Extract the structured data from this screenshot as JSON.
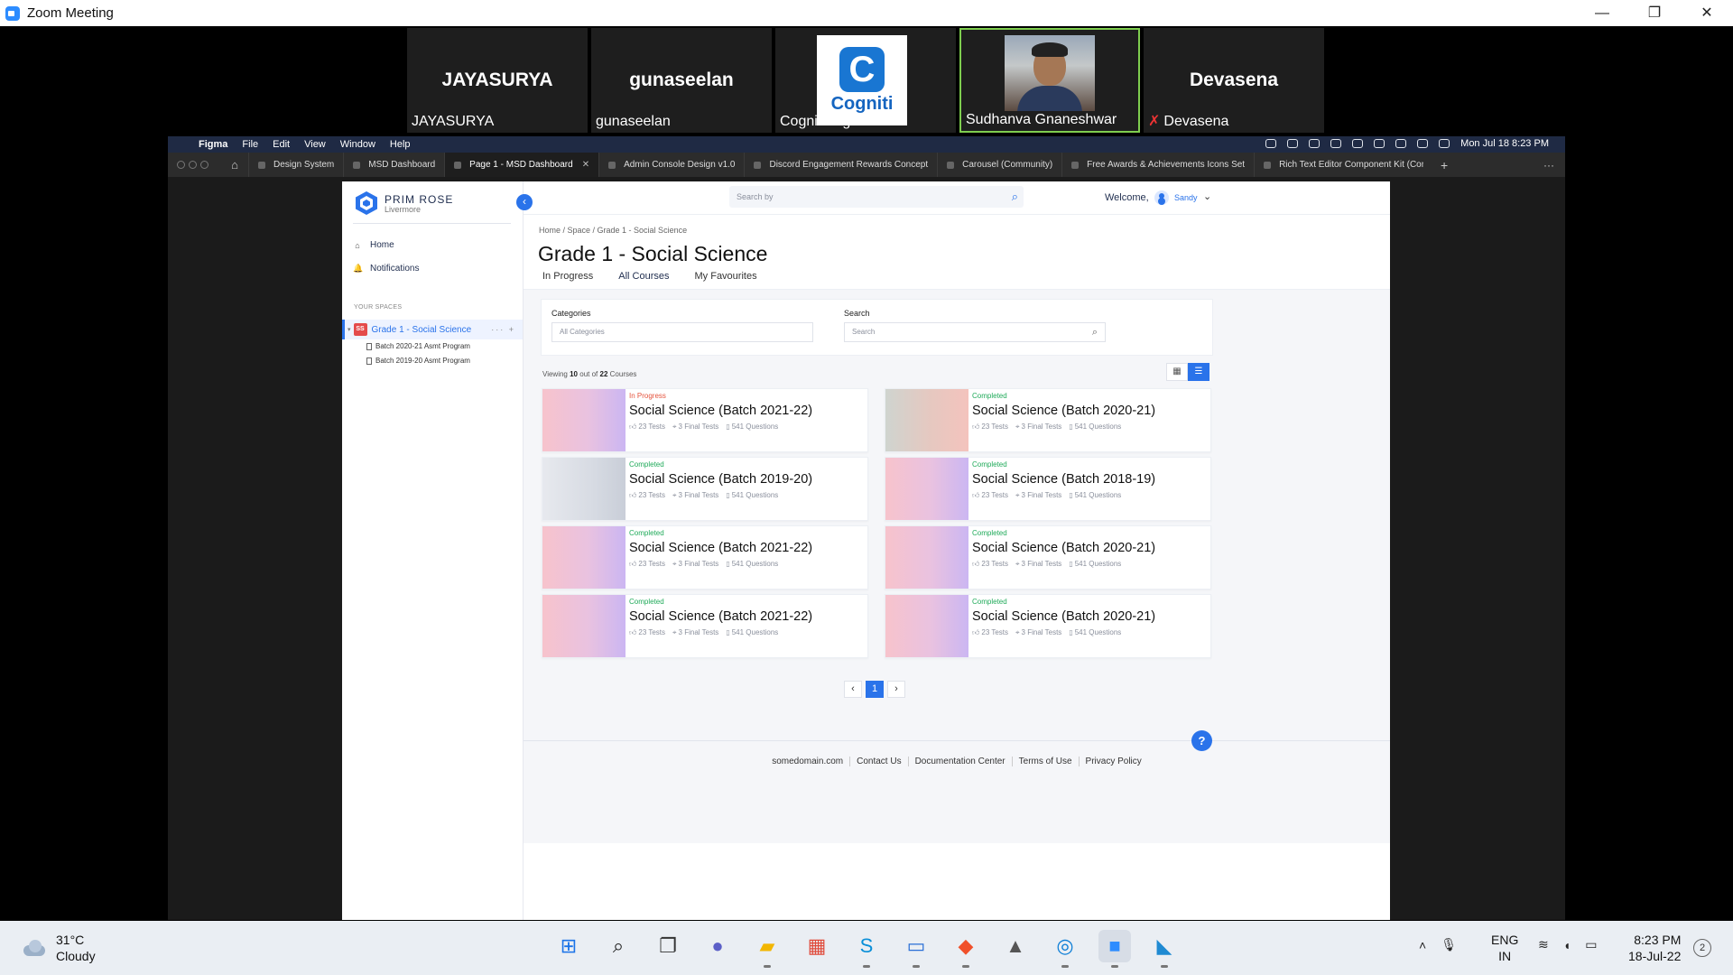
{
  "zoom": {
    "title": "Zoom Meeting",
    "window_controls": [
      "—",
      "❐",
      "✕"
    ],
    "participants": [
      {
        "display": "JAYASURYA",
        "name": "JAYASURYA",
        "kind": "text",
        "muted": false
      },
      {
        "display": "gunaseelan",
        "name": "gunaseelan",
        "kind": "text",
        "muted": false
      },
      {
        "display": "",
        "name": "Cogniti Digital",
        "kind": "logo",
        "muted": false,
        "logo_letter": "C",
        "logo_text": "Cogniti"
      },
      {
        "display": "",
        "name": "Sudhanva Gnaneshwar",
        "kind": "video",
        "muted": false,
        "active": true
      },
      {
        "display": "Devasena",
        "name": "Devasena",
        "kind": "text",
        "muted": true
      }
    ]
  },
  "mac_menubar": {
    "app": "Figma",
    "menus": [
      "File",
      "Edit",
      "View",
      "Window",
      "Help"
    ],
    "clock": "Mon Jul 18  8:23 PM"
  },
  "figma_tabs": [
    {
      "label": "Design System",
      "active": false
    },
    {
      "label": "MSD Dashboard",
      "active": false
    },
    {
      "label": "Page 1 - MSD Dashboard",
      "active": true
    },
    {
      "label": "Admin Console Design v1.0",
      "active": false
    },
    {
      "label": "Discord Engagement Rewards Concept",
      "active": false
    },
    {
      "label": "Carousel (Community)",
      "active": false
    },
    {
      "label": "Free Awards & Achievements Icons Set",
      "active": false
    },
    {
      "label": "Rich Text Editor Component Kit (Comm",
      "active": false
    }
  ],
  "app": {
    "brand": {
      "name": "PRIM ROSE",
      "location": "Livermore"
    },
    "nav": [
      {
        "label": "Home",
        "icon": "home-icon",
        "glyph": "⌂"
      },
      {
        "label": "Notifications",
        "icon": "bell-icon",
        "glyph": "🔔"
      }
    ],
    "your_spaces_label": "YOUR SPACES",
    "space": {
      "badge": "SS",
      "label": "Grade 1 - Social Science",
      "actions": "··· +"
    },
    "sub_items": [
      "Batch 2020-21 Asmt Program",
      "Batch 2019-20 Asmt Program"
    ],
    "search_placeholder": "Search by",
    "welcome": "Welcome,",
    "user": "Sandy",
    "breadcrumb": "Home / Space / Grade 1 - Social Science",
    "page_title": "Grade 1 - Social Science",
    "tabs": [
      {
        "label": "In Progress",
        "active": false
      },
      {
        "label": "All Courses",
        "active": true
      },
      {
        "label": "My Favourites",
        "active": false
      }
    ],
    "filters": {
      "categories_label": "Categories",
      "categories_value": "All Categories",
      "search_label": "Search",
      "search_placeholder": "Search"
    },
    "viewing": {
      "prefix": "Viewing",
      "shown": "10",
      "middle": "out of",
      "total": "22",
      "suffix": "Courses"
    },
    "courses": [
      {
        "status": "In Progress",
        "status_color": "#e5533d",
        "name": "Social Science (Batch 2021-22)",
        "tests": "23 Tests",
        "final": "3 Final Tests",
        "questions": "541 Questions",
        "thumb": "pink-violet"
      },
      {
        "status": "Completed",
        "status_color": "#1faa59",
        "name": "Social Science (Batch 2020-21)",
        "tests": "23 Tests",
        "final": "3 Final Tests",
        "questions": "541 Questions",
        "thumb": "grey-peach"
      },
      {
        "status": "Completed",
        "status_color": "#1faa59",
        "name": "Social Science (Batch 2019-20)",
        "tests": "23 Tests",
        "final": "3 Final Tests",
        "questions": "541 Questions",
        "thumb": "grey"
      },
      {
        "status": "Completed",
        "status_color": "#1faa59",
        "name": "Social Science (Batch 2018-19)",
        "tests": "23 Tests",
        "final": "3 Final Tests",
        "questions": "541 Questions",
        "thumb": "pink-violet"
      },
      {
        "status": "Completed",
        "status_color": "#1faa59",
        "name": "Social Science (Batch 2021-22)",
        "tests": "23 Tests",
        "final": "3 Final Tests",
        "questions": "541 Questions",
        "thumb": "pink-violet"
      },
      {
        "status": "Completed",
        "status_color": "#1faa59",
        "name": "Social Science (Batch 2020-21)",
        "tests": "23 Tests",
        "final": "3 Final Tests",
        "questions": "541 Questions",
        "thumb": "pink-violet"
      },
      {
        "status": "Completed",
        "status_color": "#1faa59",
        "name": "Social Science (Batch 2021-22)",
        "tests": "23 Tests",
        "final": "3 Final Tests",
        "questions": "541 Questions",
        "thumb": "pink-violet"
      },
      {
        "status": "Completed",
        "status_color": "#1faa59",
        "name": "Social Science (Batch 2020-21)",
        "tests": "23 Tests",
        "final": "3 Final Tests",
        "questions": "541 Questions",
        "thumb": "pink-violet"
      }
    ],
    "pagination": {
      "prev": "‹",
      "current": "1",
      "next": "›"
    },
    "help": "?",
    "footer_links": [
      "somedomain.com",
      "Contact Us",
      "Documentation Center",
      "Terms of Use",
      "Privacy Policy"
    ]
  },
  "taskbar": {
    "temperature": "31°C",
    "condition": "Cloudy",
    "apps": [
      {
        "name": "windows-start-icon",
        "glyph": "⊞",
        "color": "#1a73e8",
        "active": false
      },
      {
        "name": "search-icon",
        "glyph": "⌕",
        "color": "#222",
        "active": false
      },
      {
        "name": "task-view-icon",
        "glyph": "❐",
        "color": "#333",
        "active": false
      },
      {
        "name": "teams-chat-icon",
        "glyph": "●",
        "color": "#5b5fc7",
        "active": false
      },
      {
        "name": "file-explorer-icon",
        "glyph": "▰",
        "color": "#f2b600",
        "active": true
      },
      {
        "name": "store-icon",
        "glyph": "▦",
        "color": "#e04a3a",
        "active": false
      },
      {
        "name": "skype-icon",
        "glyph": "S",
        "color": "#0a8fd8",
        "active": true
      },
      {
        "name": "remote-desktop-icon",
        "glyph": "▭",
        "color": "#2a6fd6",
        "active": true
      },
      {
        "name": "brave-icon",
        "glyph": "◆",
        "color": "#f0502a",
        "active": true
      },
      {
        "name": "education-icon",
        "glyph": "▲",
        "color": "#555",
        "active": false
      },
      {
        "name": "sync-icon",
        "glyph": "◎",
        "color": "#0b7dd6",
        "active": true
      },
      {
        "name": "zoom-icon",
        "glyph": "■",
        "color": "#2d8cff",
        "active": true
      },
      {
        "name": "vscode-icon",
        "glyph": "◣",
        "color": "#1f8ad2",
        "active": true
      }
    ],
    "lang_line1": "ENG",
    "lang_line2": "IN",
    "time": "8:23 PM",
    "date": "18-Jul-22",
    "notifications": "2"
  }
}
